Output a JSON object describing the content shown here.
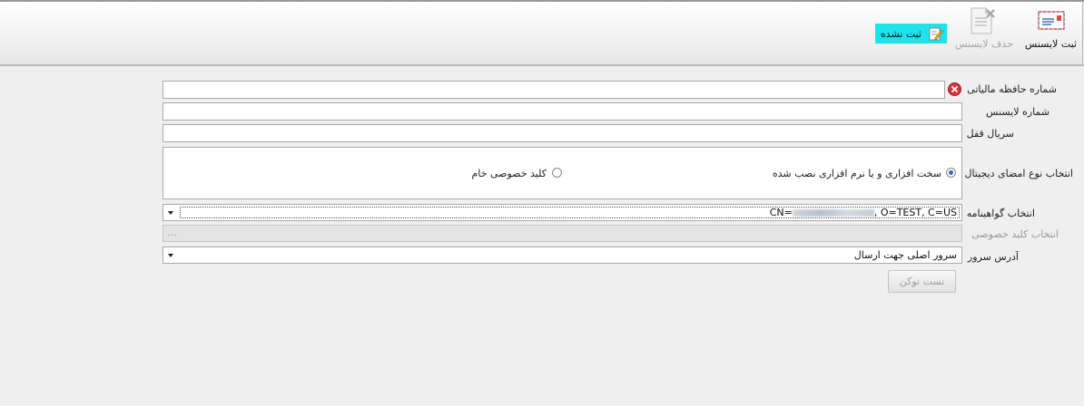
{
  "toolbar": {
    "register_license": "ثبت لایسنس",
    "delete_license": "حذف لایسنس",
    "status_badge": "ثبت نشده"
  },
  "form": {
    "tax_memory_label": "شماره حافظه مالیاتی",
    "tax_memory_value": "",
    "license_number_label": "شماره لایسنس",
    "license_number_value": "",
    "lock_serial_label": "سریال قفل",
    "lock_serial_value": "",
    "signature_type_label": "انتخاب نوع امضای دیجیتال",
    "signature_options": [
      {
        "label": "سخت افزاری و یا نرم افزاری نصب شده",
        "selected": true
      },
      {
        "label": "کلید خصوصی خام",
        "selected": false
      }
    ],
    "certificate_label": "انتخاب گواهینامه",
    "certificate_value_prefix": "CN=",
    "certificate_value_suffix": ", O=TEST, C=US",
    "private_key_label": "انتخاب کلید خصوصی",
    "private_key_browse": "...",
    "server_label": "آدرس سرور",
    "server_value": "سرور اصلی جهت ارسال",
    "test_token_button": "تست توکن"
  },
  "colors": {
    "status_badge_bg": "#1fe3ea",
    "error_icon": "#d9343a",
    "radio_selected": "#3f67b7"
  },
  "icons": {
    "register": "envelope-certificate-icon",
    "delete": "document-delete-icon",
    "status": "pencil-note-icon",
    "validation": "error-icon"
  }
}
